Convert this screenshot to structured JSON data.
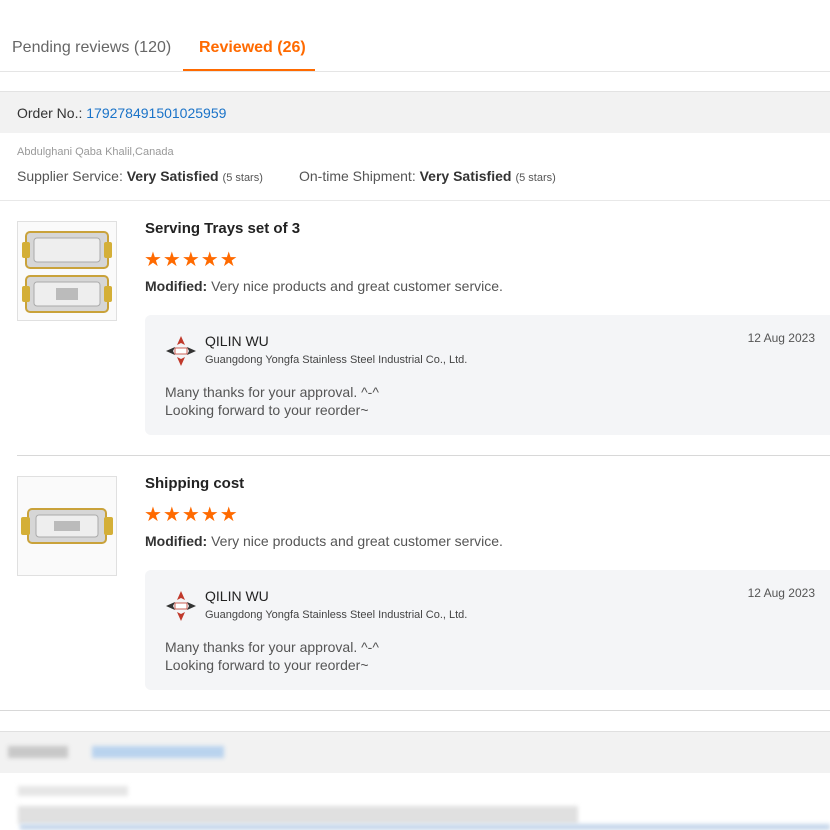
{
  "tabs": [
    {
      "label": "Pending reviews (120)"
    },
    {
      "label": "Reviewed (26)"
    }
  ],
  "order": {
    "label": "Order No.: ",
    "number": "179278491501025959"
  },
  "buyer": "Abdulghani Qaba Khalil,Canada",
  "supplier_service": {
    "label": "Supplier Service: ",
    "value": "Very Satisfied",
    "stars": "(5 stars)"
  },
  "shipment": {
    "label": "On-time Shipment: ",
    "value": "Very Satisfied",
    "stars": "(5 stars)"
  },
  "reviews": [
    {
      "title": "Serving Trays set of 3",
      "stars": "★★★★★",
      "comment_label": "Modified:",
      "comment": " Very nice products and great customer service.",
      "reply": {
        "seller": "QILIN WU",
        "company": "Guangdong Yongfa Stainless Steel Industrial Co., Ltd.",
        "date": "12 Aug 2023",
        "line1": "Many thanks for your approval. ^-^",
        "line2": "Looking forward to your reorder~"
      }
    },
    {
      "title": "Shipping cost",
      "stars": "★★★★★",
      "comment_label": "Modified:",
      "comment": " Very nice products and great customer service.",
      "reply": {
        "seller": "QILIN WU",
        "company": "Guangdong Yongfa Stainless Steel Industrial Co., Ltd.",
        "date": "12 Aug 2023",
        "line1": "Many thanks for your approval. ^-^",
        "line2": "Looking forward to your reorder~"
      }
    }
  ],
  "colors": {
    "accent": "#ff6a00",
    "link": "#1a73c8",
    "star": "#ff6a00"
  }
}
